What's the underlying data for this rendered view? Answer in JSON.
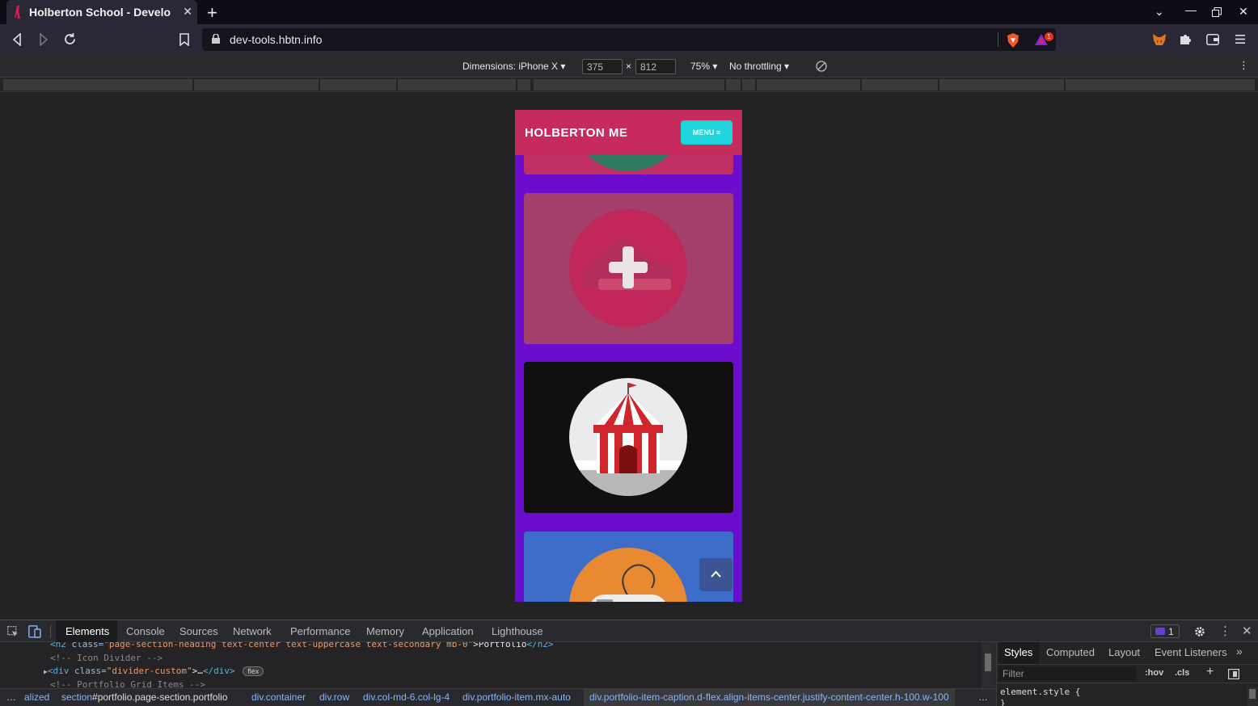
{
  "browser": {
    "tab_title": "Holberton School - Develo",
    "url": "dev-tools.hbtn.info",
    "shields_badge": "1"
  },
  "device_toolbar": {
    "dimensions_label": "Dimensions: iPhone X",
    "width": "375",
    "times": "×",
    "height": "812",
    "zoom": "75%",
    "throttling": "No throttling"
  },
  "page": {
    "brand": "HOLBERTON ME",
    "menu_label": "MENU",
    "colors": {
      "nav": "#c72a5d",
      "menu_button": "#1ed5dc",
      "background": "#6a0dcf",
      "card_pink": "#a43f6c",
      "card_dark": "#120f0f",
      "card_blue": "#3d6dc9"
    },
    "portfolio_items": [
      {
        "icon": "health-plus-icon"
      },
      {
        "icon": "circus-tent-icon"
      },
      {
        "icon": "game-controller-icon"
      }
    ]
  },
  "devtools": {
    "tabs": [
      "Elements",
      "Console",
      "Sources",
      "Network",
      "Performance",
      "Memory",
      "Application",
      "Lighthouse"
    ],
    "issues_count": "1",
    "code_lines": [
      {
        "tag_open": "<h2 ",
        "attr": "class=",
        "value": "\"page-section-heading text-center text-uppercase text-secondary mb-0\"",
        "text": ">Portfolio",
        "tag_close": "</h2>"
      },
      {
        "comment": "<!-- Icon Divider -->"
      },
      {
        "tag_open": "<div ",
        "attr": "class=",
        "value": "\"divider-custom\"",
        "text": ">…",
        "tag_close": "</div>",
        "badge": "flex"
      },
      {
        "comment": "<!-- Portfolio Grid Items -->"
      }
    ],
    "breadcrumbs": [
      {
        "prefix": "alized",
        "suffix": ""
      },
      {
        "prefix": "section",
        "suffix": "#portfolio.page-section.portfolio"
      },
      {
        "prefix": "div",
        "suffix": ".container"
      },
      {
        "prefix": "div",
        "suffix": ".row"
      },
      {
        "prefix": "div",
        "suffix": ".col-md-6.col-lg-4"
      },
      {
        "prefix": "div",
        "suffix": ".portfolio-item.mx-auto"
      },
      {
        "prefix": "div",
        "suffix": ".portfolio-item-caption.d-flex.align-items-center.justify-content-center.h-100.w-100"
      }
    ],
    "ellipsis": "…",
    "styles_tabs": [
      "Styles",
      "Computed",
      "Layout",
      "Event Listeners"
    ],
    "filter_placeholder": "Filter",
    "hov": ":hov",
    "cls": ".cls",
    "element_style": "element.style {",
    "element_style_close": "}"
  }
}
